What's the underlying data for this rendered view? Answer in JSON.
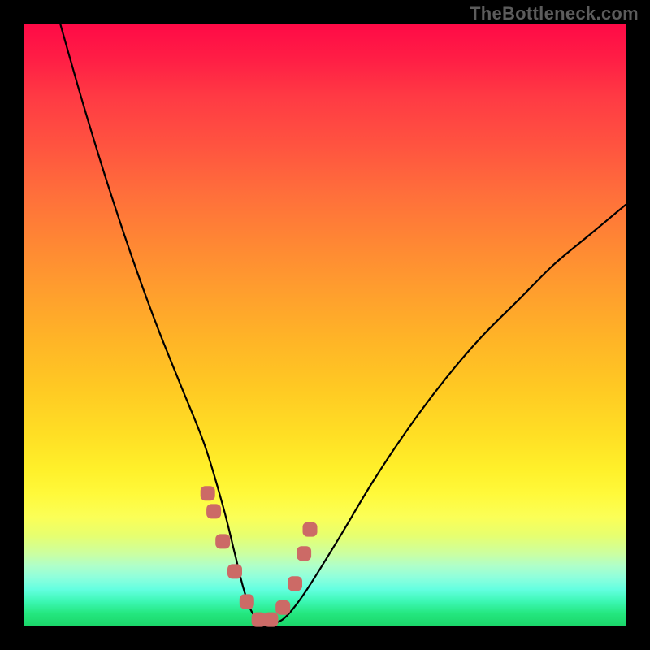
{
  "watermark": "TheBottleneck.com",
  "chart_data": {
    "type": "line",
    "title": "",
    "xlabel": "",
    "ylabel": "",
    "xlim": [
      0,
      100
    ],
    "ylim": [
      0,
      100
    ],
    "series": [
      {
        "name": "bottleneck-curve",
        "x": [
          6,
          10,
          14,
          18,
          22,
          26,
          30,
          33,
          35,
          36.5,
          38,
          40,
          42,
          44,
          47,
          52,
          58,
          64,
          70,
          76,
          82,
          88,
          94,
          100
        ],
        "values": [
          100,
          86,
          73,
          61,
          50,
          40,
          30,
          20,
          12,
          6,
          2,
          0.5,
          0.5,
          2,
          6,
          14,
          24,
          33,
          41,
          48,
          54,
          60,
          65,
          70
        ]
      }
    ],
    "markers": {
      "name": "highlight-points",
      "color": "#cc6a66",
      "x": [
        30.5,
        31.5,
        33,
        35,
        37,
        39,
        41,
        43,
        45,
        46.5,
        47.5
      ],
      "values": [
        22,
        19,
        14,
        9,
        4,
        1,
        1,
        3,
        7,
        12,
        16
      ]
    },
    "gradient_stops": [
      {
        "pos": 0.0,
        "color": "#ff0a46"
      },
      {
        "pos": 0.5,
        "color": "#ffb327"
      },
      {
        "pos": 0.8,
        "color": "#fff93a"
      },
      {
        "pos": 1.0,
        "color": "#1bd66a"
      }
    ]
  }
}
